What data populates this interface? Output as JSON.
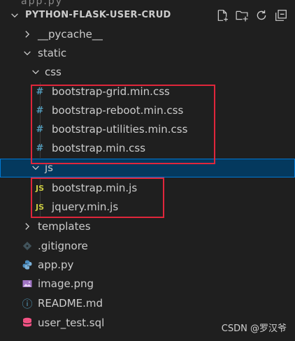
{
  "explorer": {
    "project_title": "PYTHON-FLASK-USER-CRUD",
    "top_partial_text": "app.py",
    "actions": [
      "new-file",
      "new-folder",
      "refresh",
      "collapse-all"
    ]
  },
  "tree": {
    "pycache": "__pycache__",
    "static": "static",
    "css": "css",
    "css_files": [
      "bootstrap-grid.min.css",
      "bootstrap-reboot.min.css",
      "bootstrap-utilities.min.css",
      "bootstrap.min.css"
    ],
    "js": "js",
    "js_files": [
      "bootstrap.min.js",
      "jquery.min.js"
    ],
    "templates": "templates",
    "root_files": [
      ".gitignore",
      "app.py",
      "image.png",
      "README.md",
      "user_test.sql"
    ]
  },
  "icons": {
    "css_glyph": "#",
    "js_glyph": "JS",
    "info_glyph": "ⓘ"
  },
  "colors": {
    "background": "#1f1f1f",
    "selected_row": "#04395e",
    "highlight_box": "#e0263b",
    "css_icon": "#519aba",
    "js_icon": "#cbcb41",
    "python_icon": "#4b8bbe"
  },
  "watermark": "CSDN @罗汉爷"
}
